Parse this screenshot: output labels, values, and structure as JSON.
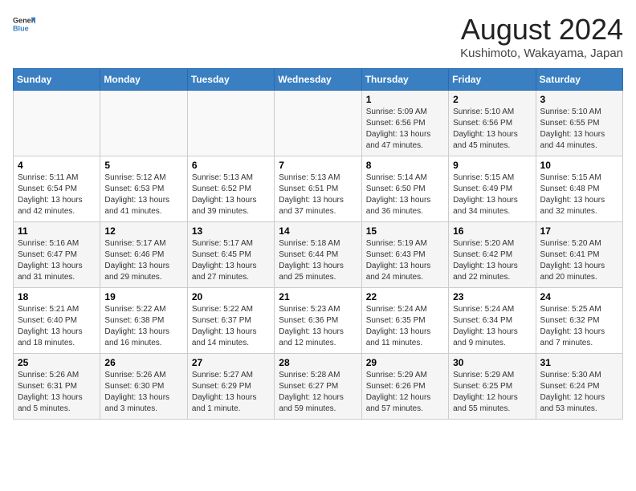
{
  "logo": {
    "line1": "General",
    "line2": "Blue"
  },
  "title": "August 2024",
  "subtitle": "Kushimoto, Wakayama, Japan",
  "weekdays": [
    "Sunday",
    "Monday",
    "Tuesday",
    "Wednesday",
    "Thursday",
    "Friday",
    "Saturday"
  ],
  "weeks": [
    [
      {
        "day": "",
        "info": ""
      },
      {
        "day": "",
        "info": ""
      },
      {
        "day": "",
        "info": ""
      },
      {
        "day": "",
        "info": ""
      },
      {
        "day": "1",
        "info": "Sunrise: 5:09 AM\nSunset: 6:56 PM\nDaylight: 13 hours\nand 47 minutes."
      },
      {
        "day": "2",
        "info": "Sunrise: 5:10 AM\nSunset: 6:56 PM\nDaylight: 13 hours\nand 45 minutes."
      },
      {
        "day": "3",
        "info": "Sunrise: 5:10 AM\nSunset: 6:55 PM\nDaylight: 13 hours\nand 44 minutes."
      }
    ],
    [
      {
        "day": "4",
        "info": "Sunrise: 5:11 AM\nSunset: 6:54 PM\nDaylight: 13 hours\nand 42 minutes."
      },
      {
        "day": "5",
        "info": "Sunrise: 5:12 AM\nSunset: 6:53 PM\nDaylight: 13 hours\nand 41 minutes."
      },
      {
        "day": "6",
        "info": "Sunrise: 5:13 AM\nSunset: 6:52 PM\nDaylight: 13 hours\nand 39 minutes."
      },
      {
        "day": "7",
        "info": "Sunrise: 5:13 AM\nSunset: 6:51 PM\nDaylight: 13 hours\nand 37 minutes."
      },
      {
        "day": "8",
        "info": "Sunrise: 5:14 AM\nSunset: 6:50 PM\nDaylight: 13 hours\nand 36 minutes."
      },
      {
        "day": "9",
        "info": "Sunrise: 5:15 AM\nSunset: 6:49 PM\nDaylight: 13 hours\nand 34 minutes."
      },
      {
        "day": "10",
        "info": "Sunrise: 5:15 AM\nSunset: 6:48 PM\nDaylight: 13 hours\nand 32 minutes."
      }
    ],
    [
      {
        "day": "11",
        "info": "Sunrise: 5:16 AM\nSunset: 6:47 PM\nDaylight: 13 hours\nand 31 minutes."
      },
      {
        "day": "12",
        "info": "Sunrise: 5:17 AM\nSunset: 6:46 PM\nDaylight: 13 hours\nand 29 minutes."
      },
      {
        "day": "13",
        "info": "Sunrise: 5:17 AM\nSunset: 6:45 PM\nDaylight: 13 hours\nand 27 minutes."
      },
      {
        "day": "14",
        "info": "Sunrise: 5:18 AM\nSunset: 6:44 PM\nDaylight: 13 hours\nand 25 minutes."
      },
      {
        "day": "15",
        "info": "Sunrise: 5:19 AM\nSunset: 6:43 PM\nDaylight: 13 hours\nand 24 minutes."
      },
      {
        "day": "16",
        "info": "Sunrise: 5:20 AM\nSunset: 6:42 PM\nDaylight: 13 hours\nand 22 minutes."
      },
      {
        "day": "17",
        "info": "Sunrise: 5:20 AM\nSunset: 6:41 PM\nDaylight: 13 hours\nand 20 minutes."
      }
    ],
    [
      {
        "day": "18",
        "info": "Sunrise: 5:21 AM\nSunset: 6:40 PM\nDaylight: 13 hours\nand 18 minutes."
      },
      {
        "day": "19",
        "info": "Sunrise: 5:22 AM\nSunset: 6:38 PM\nDaylight: 13 hours\nand 16 minutes."
      },
      {
        "day": "20",
        "info": "Sunrise: 5:22 AM\nSunset: 6:37 PM\nDaylight: 13 hours\nand 14 minutes."
      },
      {
        "day": "21",
        "info": "Sunrise: 5:23 AM\nSunset: 6:36 PM\nDaylight: 13 hours\nand 12 minutes."
      },
      {
        "day": "22",
        "info": "Sunrise: 5:24 AM\nSunset: 6:35 PM\nDaylight: 13 hours\nand 11 minutes."
      },
      {
        "day": "23",
        "info": "Sunrise: 5:24 AM\nSunset: 6:34 PM\nDaylight: 13 hours\nand 9 minutes."
      },
      {
        "day": "24",
        "info": "Sunrise: 5:25 AM\nSunset: 6:32 PM\nDaylight: 13 hours\nand 7 minutes."
      }
    ],
    [
      {
        "day": "25",
        "info": "Sunrise: 5:26 AM\nSunset: 6:31 PM\nDaylight: 13 hours\nand 5 minutes."
      },
      {
        "day": "26",
        "info": "Sunrise: 5:26 AM\nSunset: 6:30 PM\nDaylight: 13 hours\nand 3 minutes."
      },
      {
        "day": "27",
        "info": "Sunrise: 5:27 AM\nSunset: 6:29 PM\nDaylight: 13 hours\nand 1 minute."
      },
      {
        "day": "28",
        "info": "Sunrise: 5:28 AM\nSunset: 6:27 PM\nDaylight: 12 hours\nand 59 minutes."
      },
      {
        "day": "29",
        "info": "Sunrise: 5:29 AM\nSunset: 6:26 PM\nDaylight: 12 hours\nand 57 minutes."
      },
      {
        "day": "30",
        "info": "Sunrise: 5:29 AM\nSunset: 6:25 PM\nDaylight: 12 hours\nand 55 minutes."
      },
      {
        "day": "31",
        "info": "Sunrise: 5:30 AM\nSunset: 6:24 PM\nDaylight: 12 hours\nand 53 minutes."
      }
    ]
  ]
}
